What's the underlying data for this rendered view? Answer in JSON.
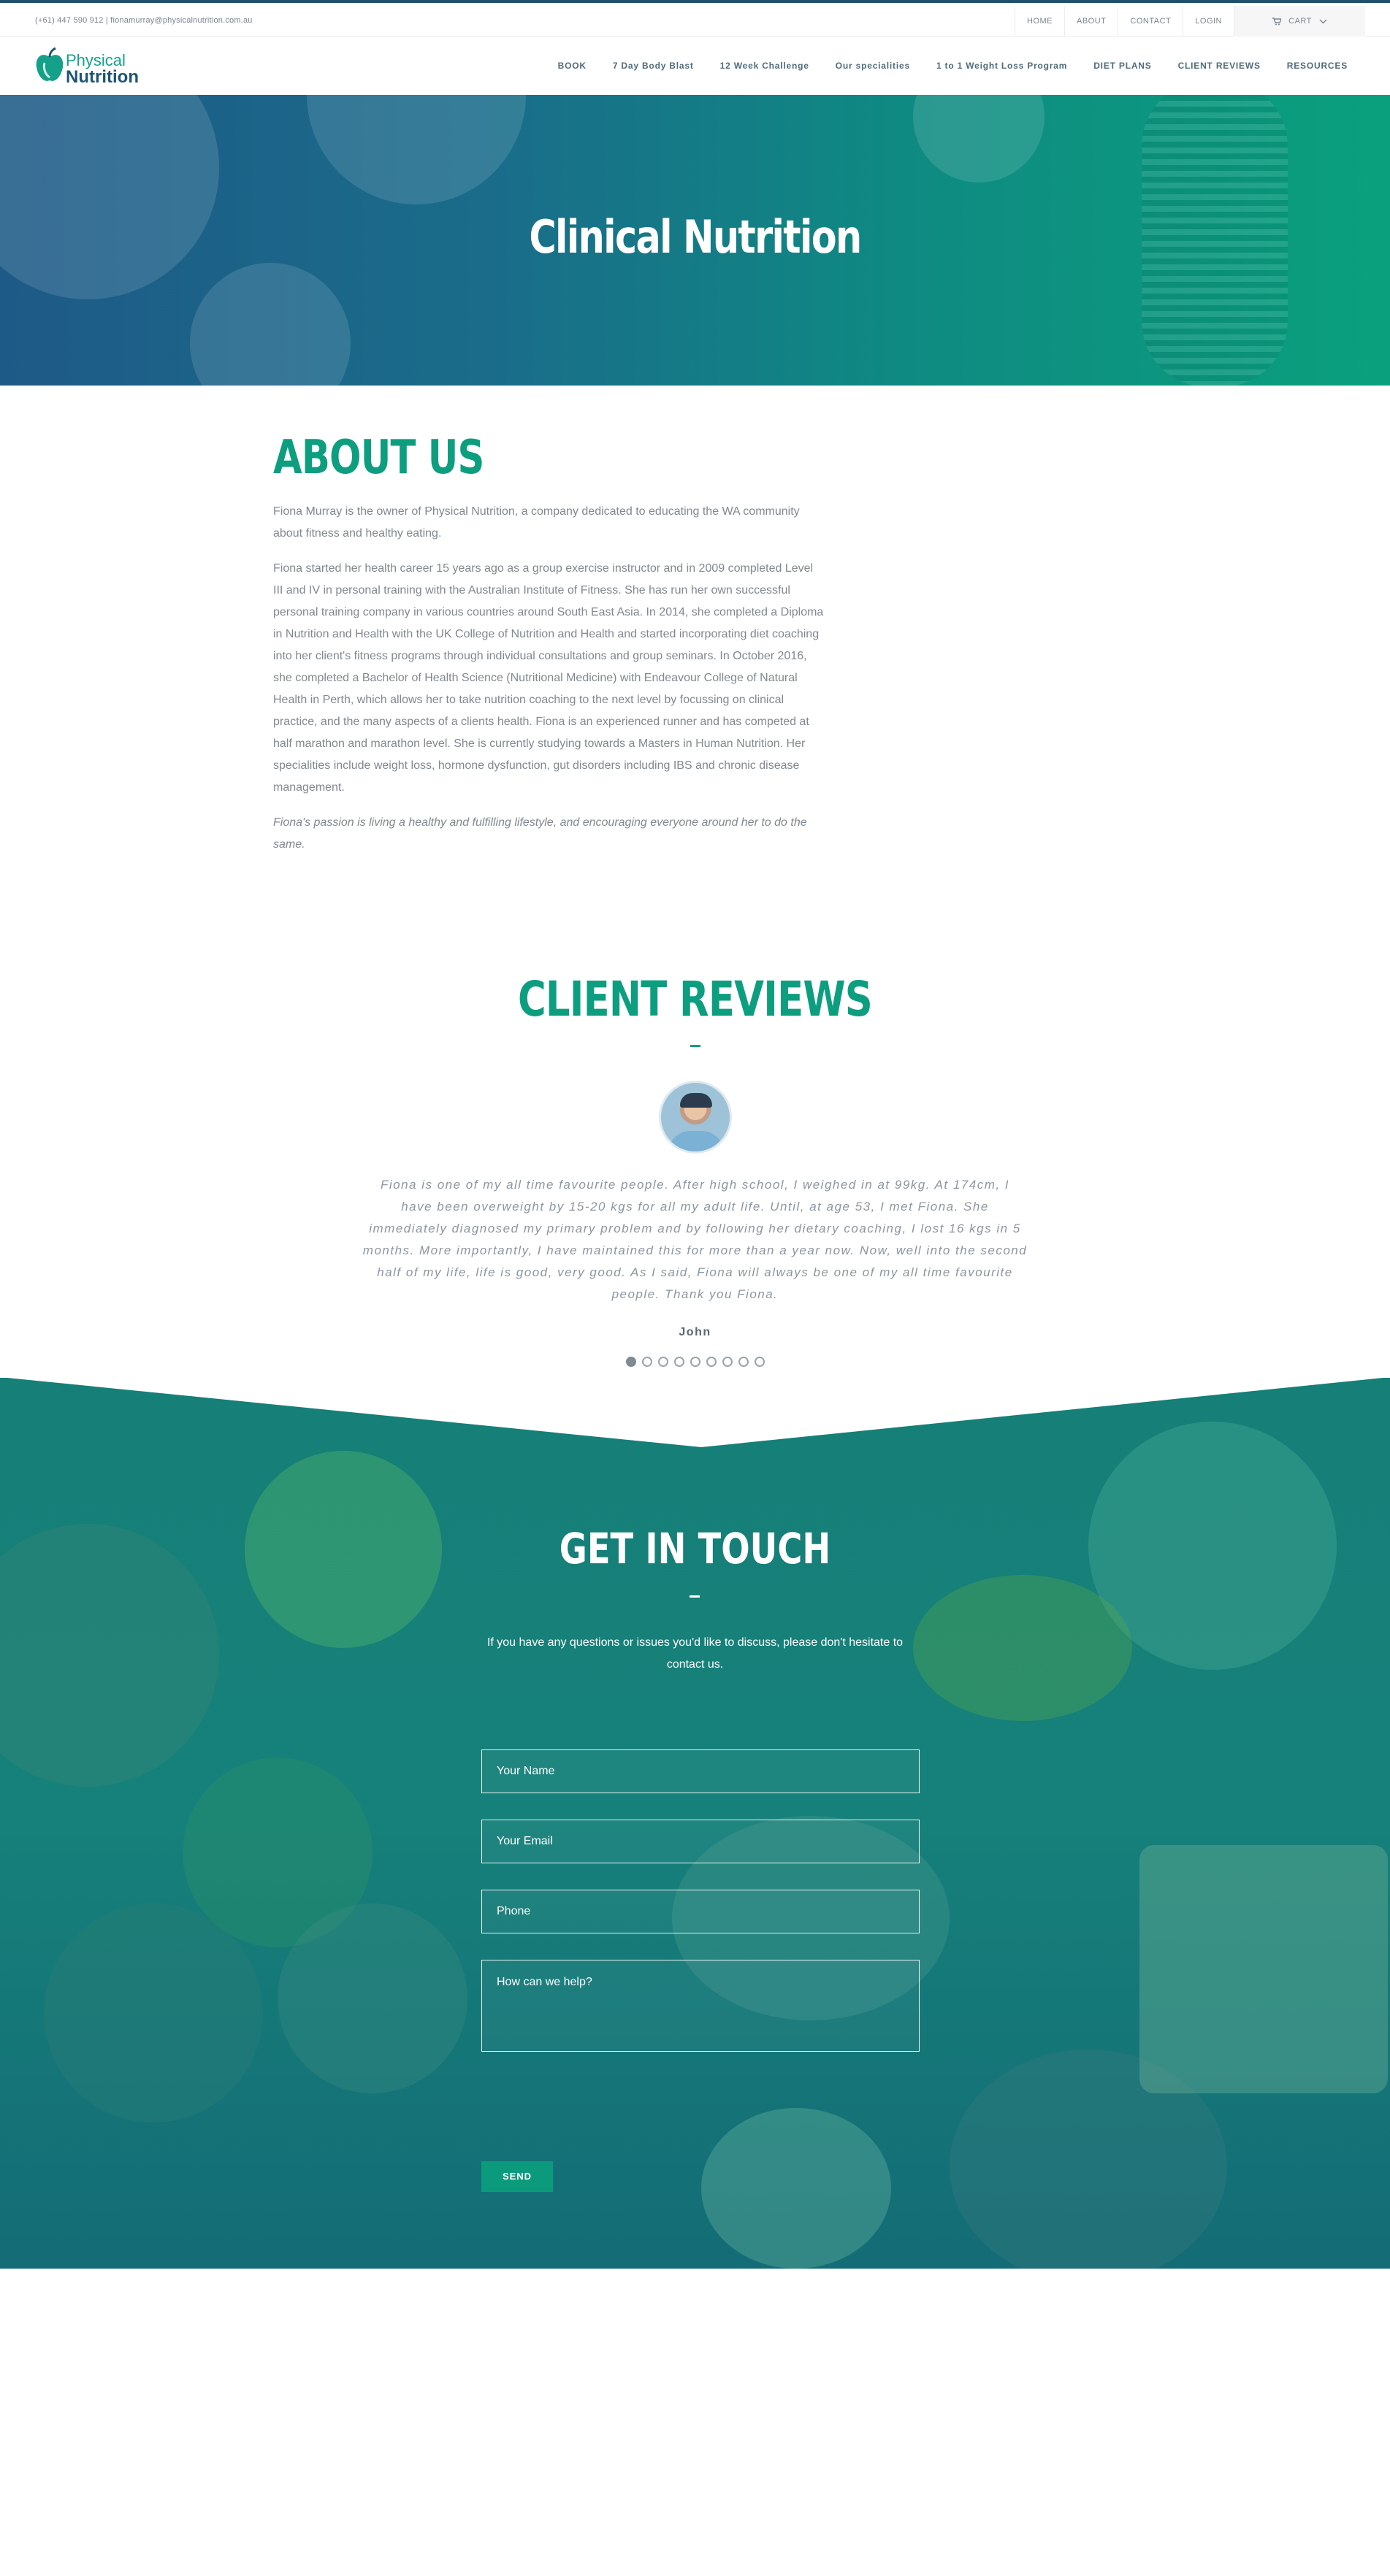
{
  "topbar": {
    "contact": "(+61) 447 590 912  |  fionamurray@physicalnutrition.com.au",
    "links": [
      "HOME",
      "ABOUT",
      "CONTACT",
      "LOGIN"
    ],
    "cart_label": "CART"
  },
  "brand": {
    "line1": "Physical",
    "line2": "Nutrition"
  },
  "nav": [
    "BOOK",
    "7 Day Body Blast",
    "12 Week Challenge",
    "Our specialities",
    "1 to 1 Weight Loss Program",
    "DIET PLANS",
    "CLIENT REVIEWS",
    "RESOURCES"
  ],
  "hero": {
    "title": "Clinical Nutrition"
  },
  "about": {
    "heading": "ABOUT US",
    "p1": "Fiona Murray is the owner of Physical Nutrition, a company dedicated to educating the WA community about fitness and healthy eating.",
    "p2": "Fiona started her health career 15 years ago as a group exercise instructor and in 2009 completed Level III and IV in personal training with the Australian Institute of Fitness. She has run her own successful personal training company in various countries around South East Asia. In 2014, she completed a Diploma in Nutrition and Health with the UK College of Nutrition and Health and started incorporating diet coaching into her client's fitness programs through individual consultations and group seminars. In October 2016, she completed a Bachelor of Health Science (Nutritional Medicine) with Endeavour College of Natural Health in Perth, which allows her to take nutrition coaching to the next level by focussing on clinical practice, and the many aspects of a clients health. Fiona is an experienced runner and has competed at half marathon and marathon level. She is currently studying towards a Masters in Human Nutrition. Her specialities include weight loss, hormone dysfunction, gut disorders including IBS and chronic disease management.",
    "p3": "Fiona's passion is living a healthy and fulfilling lifestyle, and encouraging everyone around her to do the same."
  },
  "reviews": {
    "heading": "CLIENT REVIEWS",
    "quote": "Fiona is one of my all time favourite people. After high school, I weighed in at 99kg. At 174cm, I have been overweight by 15-20 kgs for all my adult life. Until, at age 53, I met Fiona. She immediately diagnosed my primary problem and by following her dietary coaching, I lost 16 kgs in 5 months. More importantly, I have maintained this for more than a year now. Now, well into the second half of my life, life is good, very good. As I said, Fiona will always be one of my all time favourite people. Thank you Fiona.",
    "author": "John",
    "slide_count": 9,
    "active_slide": 1
  },
  "contact": {
    "heading": "GET IN TOUCH",
    "intro": "If you have any questions or issues you'd like to discuss, please don't hesitate to contact us.",
    "name_placeholder": "Your Name",
    "email_placeholder": "Your Email",
    "phone_placeholder": "Phone",
    "message_placeholder": "How can we help?",
    "send_label": "SEND"
  },
  "colors": {
    "brand_green": "#0d9e80",
    "brand_navy": "#1e5478"
  }
}
